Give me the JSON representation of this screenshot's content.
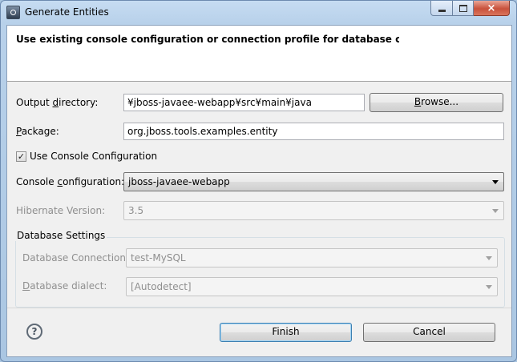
{
  "window": {
    "title": "Generate Entities",
    "buttons": {
      "minimize": "minimize-icon",
      "maximize": "maximize-icon",
      "close": "×"
    }
  },
  "banner": {
    "message": "Use existing console configuration or connection profile for database connect"
  },
  "form": {
    "output_directory": {
      "label_before": "Output ",
      "label_mnemonic": "d",
      "label_after": "irectory:",
      "value": "¥jboss-javaee-webapp¥src¥main¥java",
      "browse_before": "",
      "browse_mnemonic": "B",
      "browse_after": "rowse..."
    },
    "package": {
      "label_mnemonic": "P",
      "label_after": "ackage:",
      "value": "org.jboss.tools.examples.entity"
    },
    "use_console": {
      "label": "Use Console Configuration",
      "checked": "✓"
    },
    "console_configuration": {
      "label_before": "Console ",
      "label_mnemonic": "c",
      "label_after": "onfiguration:",
      "value": "jboss-javaee-webapp"
    },
    "hibernate_version": {
      "label": "Hibernate Version:",
      "value": "3.5"
    }
  },
  "database_settings": {
    "title": "Database Settings",
    "connection": {
      "label": "Database Connection",
      "value": "test-MySQL"
    },
    "dialect": {
      "label_mnemonic": "D",
      "label_after": "atabase dialect:",
      "value": "[Autodetect]"
    }
  },
  "footer": {
    "help": "?",
    "finish": "Finish",
    "cancel": "Cancel"
  }
}
